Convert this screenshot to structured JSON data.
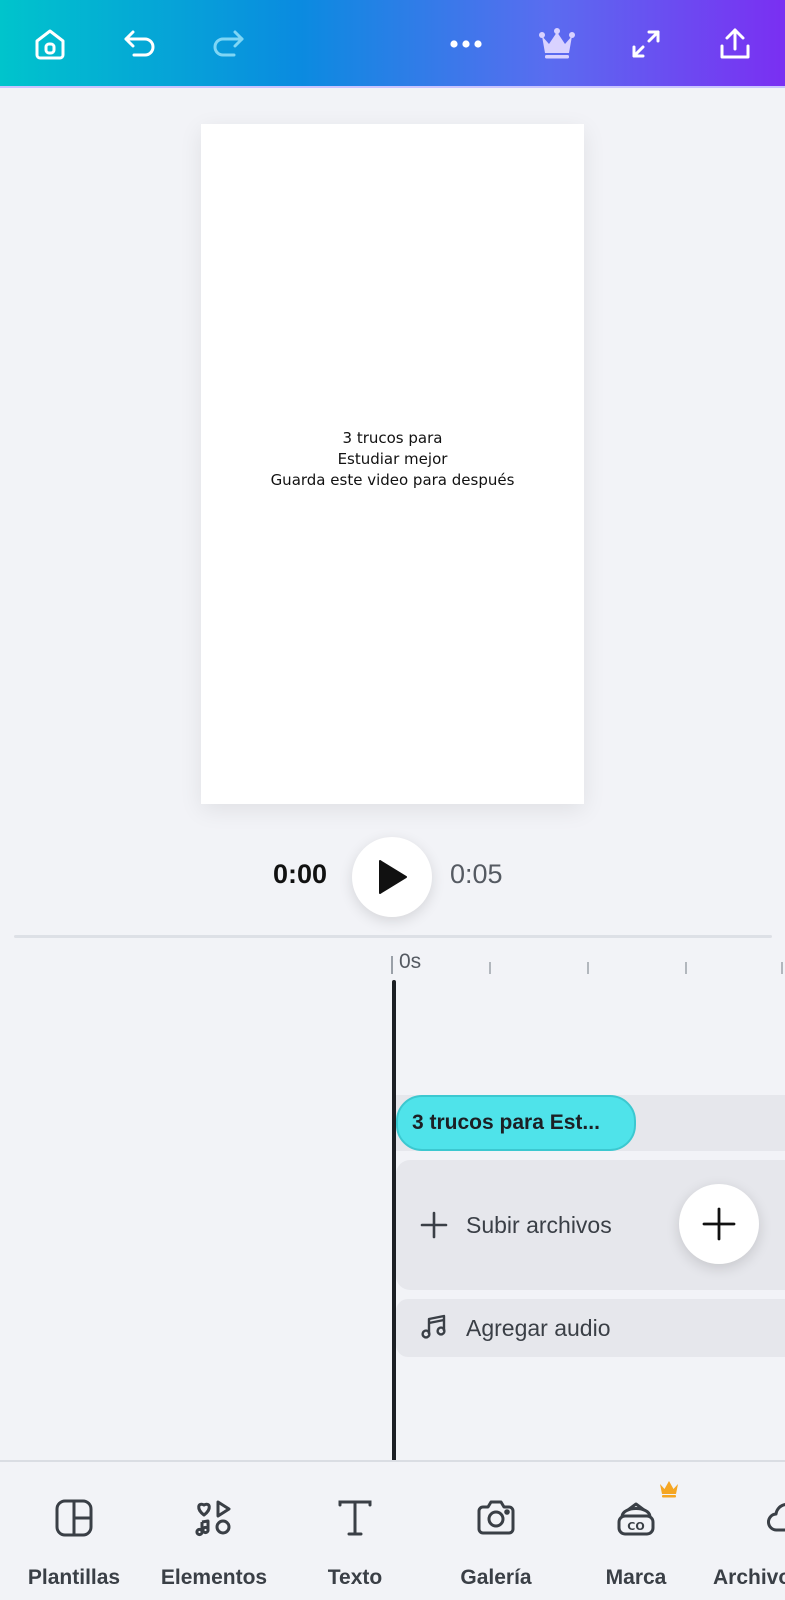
{
  "toolbar": {
    "icons": [
      "home-icon",
      "undo-icon",
      "redo-icon",
      "more-icon",
      "crown-icon",
      "expand-icon",
      "share-icon"
    ]
  },
  "canvas": {
    "lines": [
      "3 trucos para",
      "Estudiar mejor",
      "Guarda este video para después"
    ]
  },
  "playback": {
    "current_time": "0:00",
    "total_time": "0:05"
  },
  "timeline": {
    "ruler_label": "0s",
    "text_clip_label": "3 trucos para Est...",
    "upload_label": "Subir archivos",
    "audio_label": "Agregar audio"
  },
  "bottom_nav": {
    "items": [
      {
        "label": "Plantillas",
        "icon": "templates-icon"
      },
      {
        "label": "Elementos",
        "icon": "elements-icon"
      },
      {
        "label": "Texto",
        "icon": "text-icon"
      },
      {
        "label": "Galería",
        "icon": "camera-icon"
      },
      {
        "label": "Marca",
        "icon": "brand-icon"
      },
      {
        "label": "Archivos",
        "icon": "cloud-icon"
      }
    ]
  },
  "colors": {
    "gradient_start": "#00c4cc",
    "gradient_end": "#7a2ff2",
    "text_clip": "#4fe3ea",
    "premium_crown": "#f5a623"
  }
}
